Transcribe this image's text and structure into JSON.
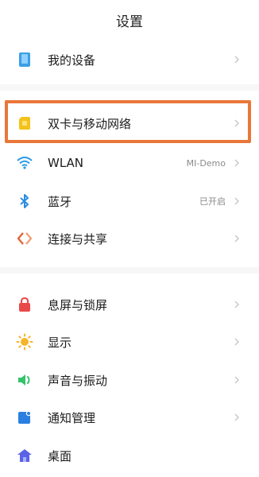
{
  "header": {
    "title": "设置"
  },
  "items": [
    {
      "label": "我的设备",
      "value": "",
      "icon": "phone-icon"
    },
    {
      "label": "双卡与移动网络",
      "value": "",
      "icon": "sim-card-icon"
    },
    {
      "label": "WLAN",
      "value": "MI-Demo",
      "icon": "wifi-icon"
    },
    {
      "label": "蓝牙",
      "value": "已开启",
      "icon": "bluetooth-icon"
    },
    {
      "label": "连接与共享",
      "value": "",
      "icon": "connection-share-icon"
    },
    {
      "label": "息屏与锁屏",
      "value": "",
      "icon": "lock-icon"
    },
    {
      "label": "显示",
      "value": "",
      "icon": "brightness-icon"
    },
    {
      "label": "声音与振动",
      "value": "",
      "icon": "speaker-icon"
    },
    {
      "label": "通知管理",
      "value": "",
      "icon": "notification-icon"
    },
    {
      "label": "桌面",
      "value": "",
      "icon": "home-icon"
    }
  ],
  "colors": {
    "highlight": "#e8773a",
    "phone": "#3aa0e6",
    "sim": "#f3c21b",
    "wifi": "#2b9be8",
    "bluetooth": "#2b8be0",
    "connection": "#e2633b",
    "lock": "#e84a4a",
    "brightness": "#f5b52a",
    "speaker": "#35c26b",
    "notification": "#2b7fe0",
    "home": "#5a63e6"
  }
}
